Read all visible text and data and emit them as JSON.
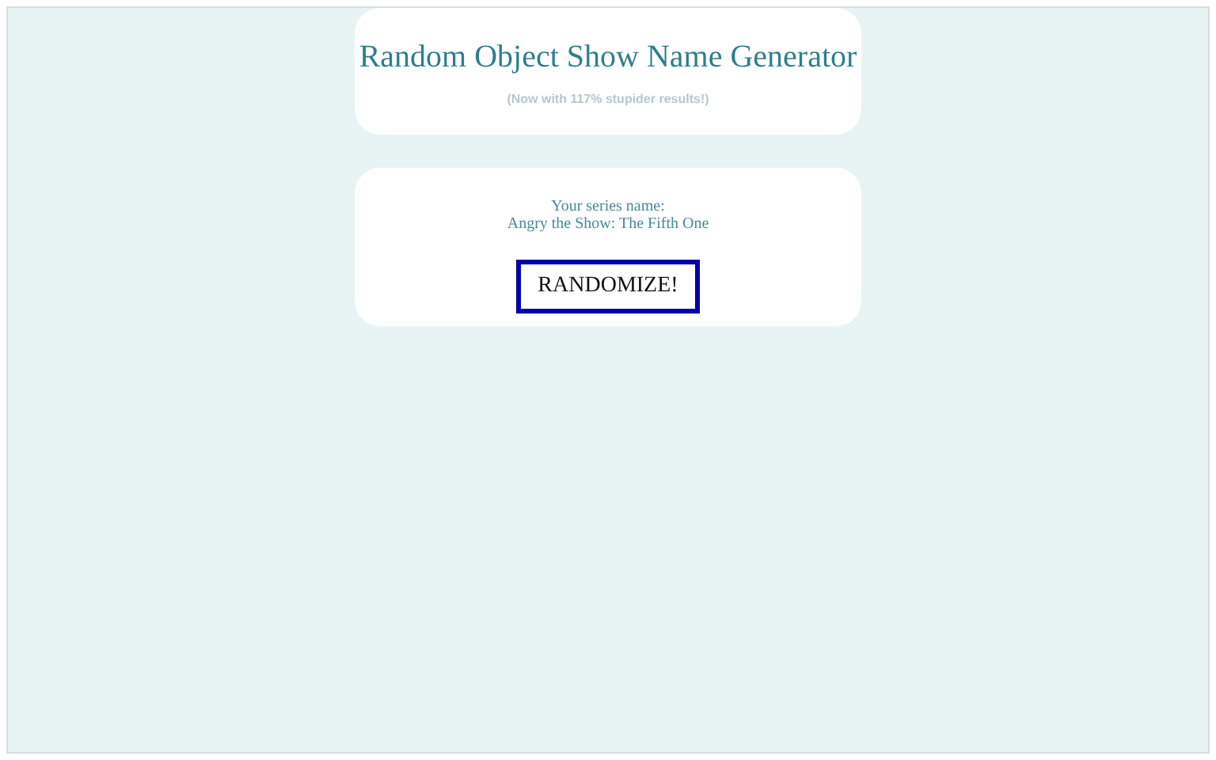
{
  "header": {
    "title": "Random Object Show Name Generator",
    "subtitle": "(Now with 117% stupider results!)"
  },
  "result": {
    "label": "Your series name:",
    "value": "Angry the Show: The Fifth One",
    "button": "RANDOMIZE!"
  }
}
